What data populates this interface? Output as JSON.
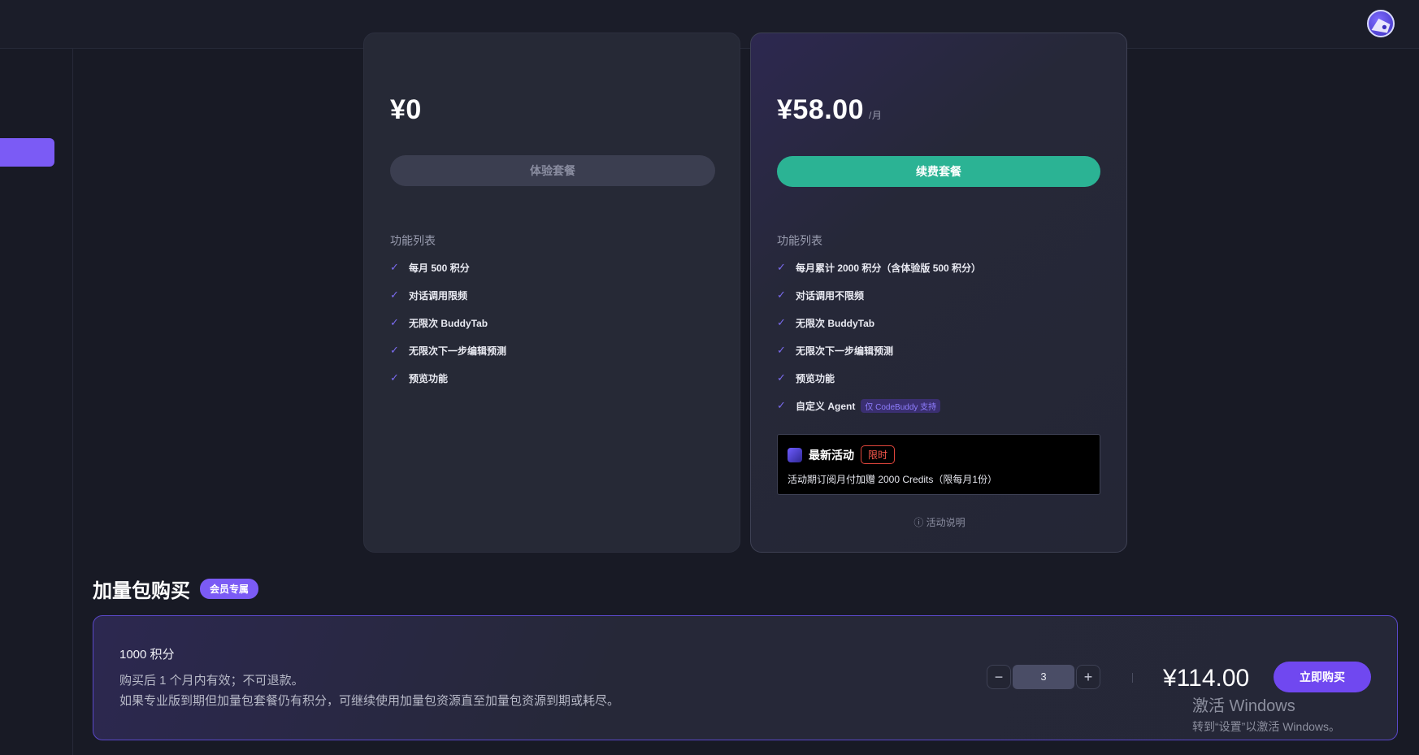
{
  "topbar": {
    "avatar": "user-avatar"
  },
  "plans": {
    "free": {
      "price": "¥0",
      "button": "体验套餐",
      "features_title": "功能列表",
      "features": [
        "每月 500 积分",
        "对话调用限频",
        "无限次 BuddyTab",
        "无限次下一步编辑预测",
        "预览功能"
      ]
    },
    "pro": {
      "price": "¥58.00",
      "per": "/月",
      "button": "续费套餐",
      "features_title": "功能列表",
      "features": [
        "每月累计 2000 积分（含体验版 500 积分）",
        "对话调用不限频",
        "无限次 BuddyTab",
        "无限次下一步编辑预测",
        "预览功能",
        "自定义 Agent"
      ],
      "agent_tag": "仅 CodeBuddy 支持",
      "promo": {
        "title": "最新活动",
        "badge": "限时",
        "desc": "活动期订阅月付加赠 2000 Credits（限每月1份）"
      },
      "promo_info": "ⓘ 活动说明"
    }
  },
  "addon": {
    "title": "加量包购买",
    "badge": "会员专属",
    "name": "1000 积分",
    "desc_line1": "购买后 1 个月内有效；不可退款。",
    "desc_line2": "如果专业版到期但加量包套餐仍有积分，可继续使用加量包资源直至加量包资源到期或耗尽。",
    "quantity": "3",
    "minus": "−",
    "plus": "+",
    "price": "¥114.00",
    "buy": "立即购买"
  },
  "watermark": {
    "line1": "激活 Windows",
    "line2": "转到“设置”以激活 Windows。"
  },
  "colors": {
    "accent": "#7b5bf5",
    "renew": "#2bb394",
    "promo_badge": "#ff5a4e"
  }
}
